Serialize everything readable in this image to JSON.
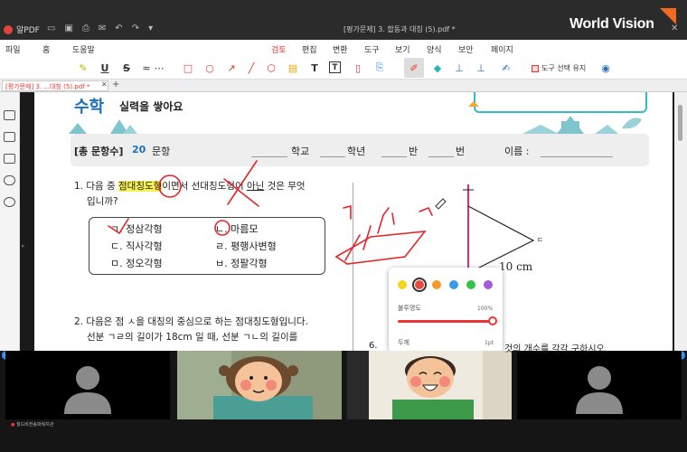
{
  "app": {
    "name": "알PDF",
    "document_title": "[평가문제] 3. 합동과 대칭 (5).pdf *",
    "brand": "World Vision"
  },
  "menu": {
    "items": [
      "파일",
      "홈",
      "도움말",
      "검토",
      "편집",
      "변환",
      "도구",
      "보기",
      "양식",
      "보안",
      "페이지"
    ],
    "active": "검토"
  },
  "toolbar": {
    "keep_tool_label": "도구 선택 유지"
  },
  "tab": {
    "label": "[평가문제] 3. ...대칭 (5).pdf *"
  },
  "worksheet": {
    "subject": "수학",
    "subtitle": "실력을 쌓아요",
    "header": {
      "total_label": "[총 문항수]",
      "total_count": "20",
      "count_unit": "문항",
      "school": "학교",
      "grade": "학년",
      "class": "반",
      "number": "번",
      "name": "이름 :"
    },
    "q1": {
      "line1_pre": "1. 다음 중 ",
      "line1_hl": "점대칭도형",
      "line1_mid": "이면서 선대칭도형이 ",
      "line1_u": "아닌",
      "line1_post": " 것은 무엇",
      "line2": "입니까?"
    },
    "choices": [
      "ㄱ. 정삼각형",
      "ㄴ. 마름모",
      "ㄷ. 직사각형",
      "ㄹ. 평행사변형",
      "ㅁ. 정오각형",
      "ㅂ. 정팔각형"
    ],
    "q2": {
      "line1": "2. 다음은 점 ㅅ을 대칭의 중심으로 하는 점대칭도형입니다.",
      "line2": "선분 ㄱㄹ의 길이가  18cm 일 때, 선분 ㄱㄴ의 길이를"
    },
    "figure": {
      "vertex_label": "ㄷ",
      "length_label": "10 cm"
    },
    "q6": {
      "num": "6.",
      "text_right": "것의 개수를 각각 구하시오."
    }
  },
  "pen_popup": {
    "colors": [
      "#f5d520",
      "#e84a3c",
      "#f59a2b",
      "#3a9be8",
      "#34c34a",
      "#a25be0"
    ],
    "selected_color": "#e84a3c",
    "opacity_label": "불투명도",
    "opacity_value": "100%",
    "opacity_fraction": 1.0,
    "thickness_label": "두께",
    "thickness_value": "1pt"
  },
  "participants": [
    {
      "name": "월드비전송파복지관",
      "video": false
    },
    {
      "name": "",
      "video": true
    },
    {
      "name": "",
      "video": true
    },
    {
      "name": "",
      "video": false
    }
  ]
}
